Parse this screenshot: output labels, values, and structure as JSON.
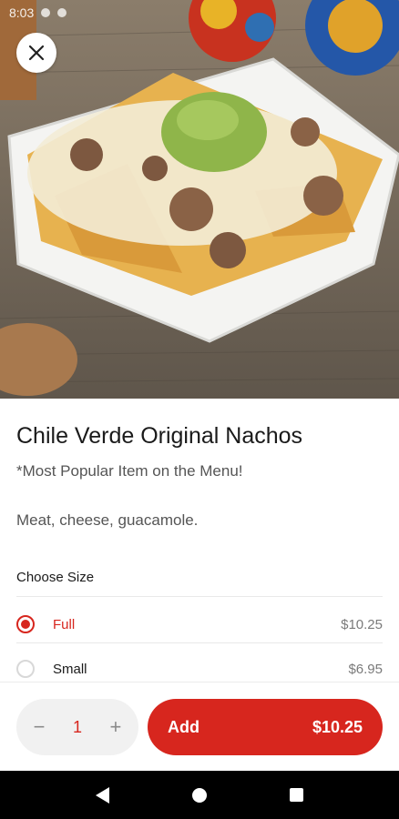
{
  "status_bar": {
    "time": "8:03"
  },
  "item": {
    "title": "Chile Verde Original Nachos",
    "subtitle": "*Most Popular Item on the Menu!",
    "description": "Meat, cheese, guacamole."
  },
  "size_section": {
    "label": "Choose Size",
    "options": [
      {
        "label": "Full",
        "price": "$10.25",
        "selected": true
      },
      {
        "label": "Small",
        "price": "$6.95",
        "selected": false
      }
    ]
  },
  "footer": {
    "quantity": "1",
    "minus_symbol": "−",
    "plus_symbol": "+",
    "add_label": "Add",
    "add_price": "$10.25"
  },
  "colors": {
    "accent": "#d7261e",
    "qty_bg": "#f1f1f1"
  },
  "icons": {
    "close": "close-icon",
    "back": "back-icon",
    "home": "home-icon",
    "recents": "recents-icon"
  }
}
